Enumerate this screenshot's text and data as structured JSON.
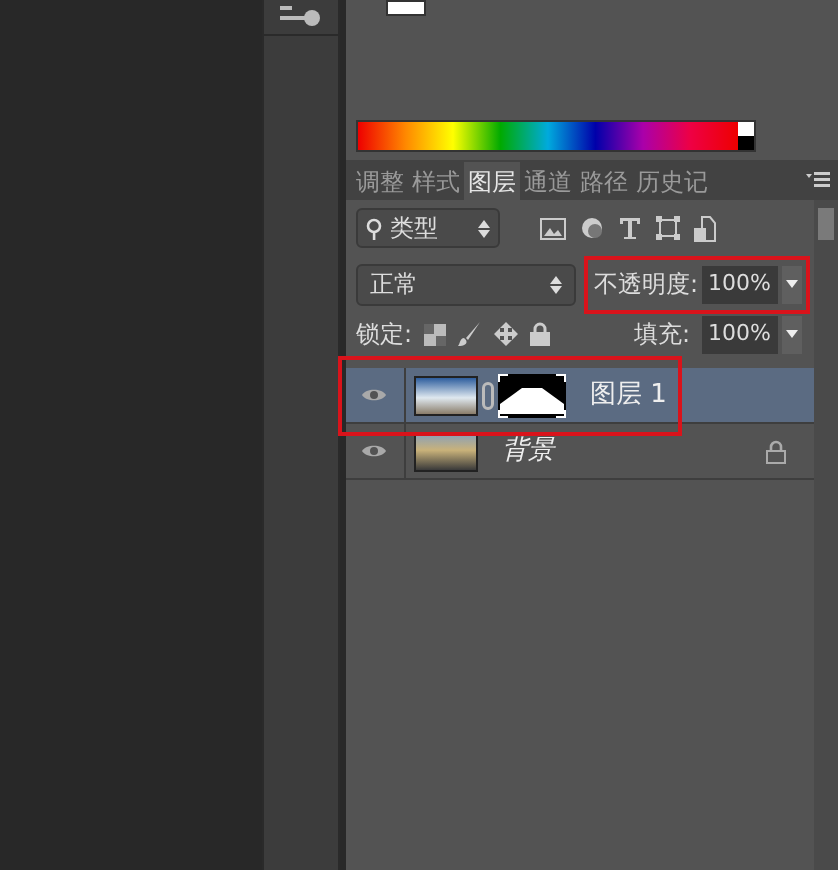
{
  "tabs": [
    {
      "label": "调整",
      "selected": false
    },
    {
      "label": "样式",
      "selected": false
    },
    {
      "label": "图层",
      "selected": true
    },
    {
      "label": "通道",
      "selected": false
    },
    {
      "label": "路径",
      "selected": false
    },
    {
      "label": "历史记",
      "selected": false
    }
  ],
  "filter": {
    "value": "类型"
  },
  "blend_mode": {
    "value": "正常"
  },
  "opacity": {
    "label": "不透明度:",
    "value": "100%"
  },
  "lock": {
    "label": "锁定:"
  },
  "fill": {
    "label": "填充:",
    "value": "100%"
  },
  "layers": [
    {
      "name": "图层",
      "suffix": "1",
      "kind": "masked",
      "selected": true,
      "visible": true
    },
    {
      "name": "背景",
      "kind": "background",
      "selected": false,
      "visible": true
    }
  ]
}
